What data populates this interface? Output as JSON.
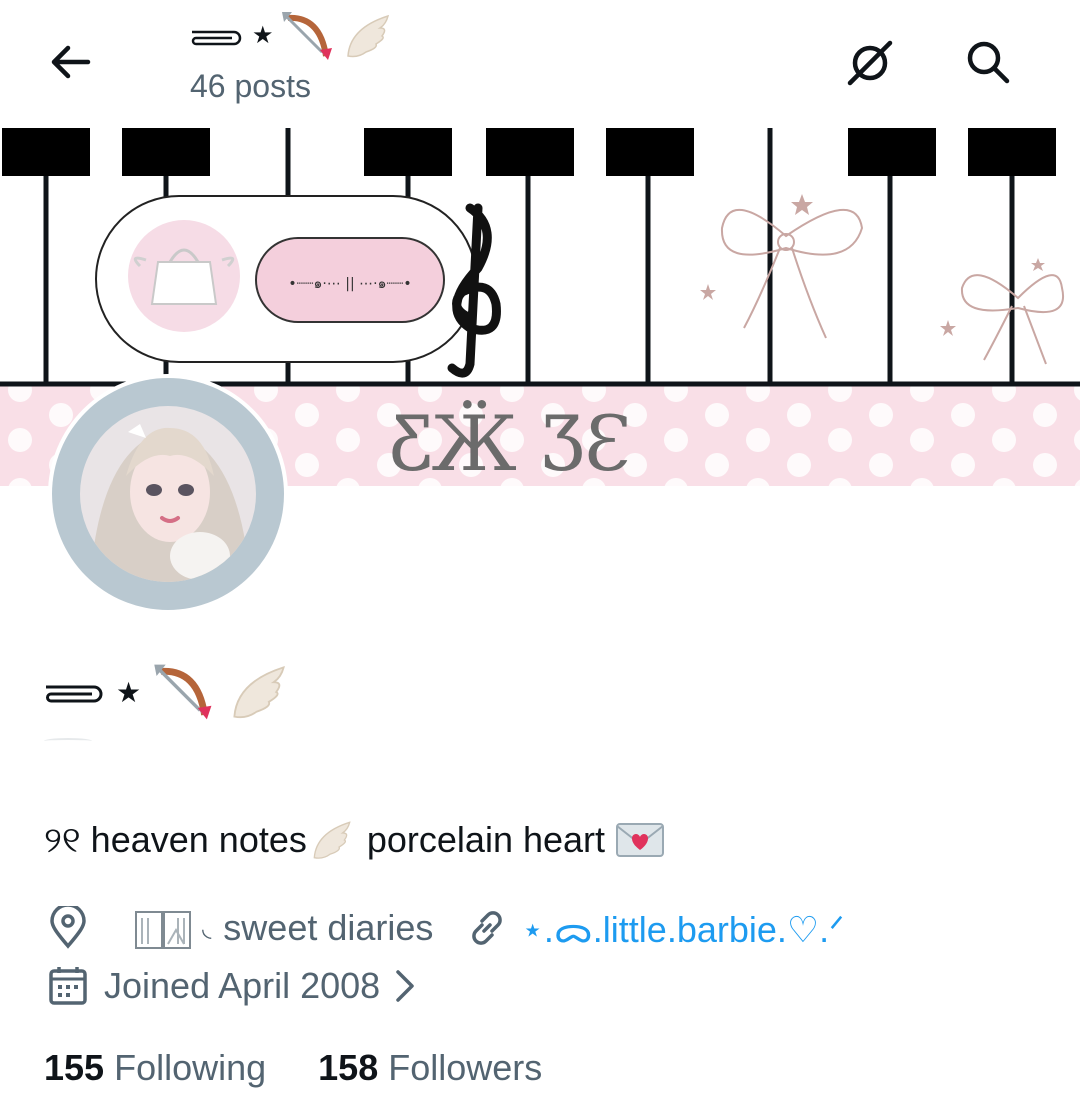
{
  "header": {
    "back_icon": "arrow-left-icon",
    "display_name_text": "★",
    "post_count": "46 posts",
    "grok_icon": "slashed-circle-icon",
    "search_icon": "search-icon"
  },
  "banner": {
    "player_text": "•┈┈๑⋅⋯ || ⋯⋅๑┈┈•",
    "glyphs": "ƸӜ ƷƐ"
  },
  "profile": {
    "name_star": "★",
    "bio_prefix": "୨୧ heaven notes",
    "bio_suffix": "porcelain heart",
    "location": "sweet diaries",
    "location_prefix": "◟",
    "website": "⋆.ᯅ.little.barbie.♡.ᐟ",
    "joined": "Joined April 2008",
    "following_count": "155",
    "following_label": "Following",
    "followers_count": "158",
    "followers_label": "Followers"
  },
  "colors": {
    "text_primary": "#0f1419",
    "text_secondary": "#536471",
    "link": "#1d9bf0",
    "avatar_ring": "#b9c8d1",
    "banner_pink": "#f9dfe7"
  }
}
